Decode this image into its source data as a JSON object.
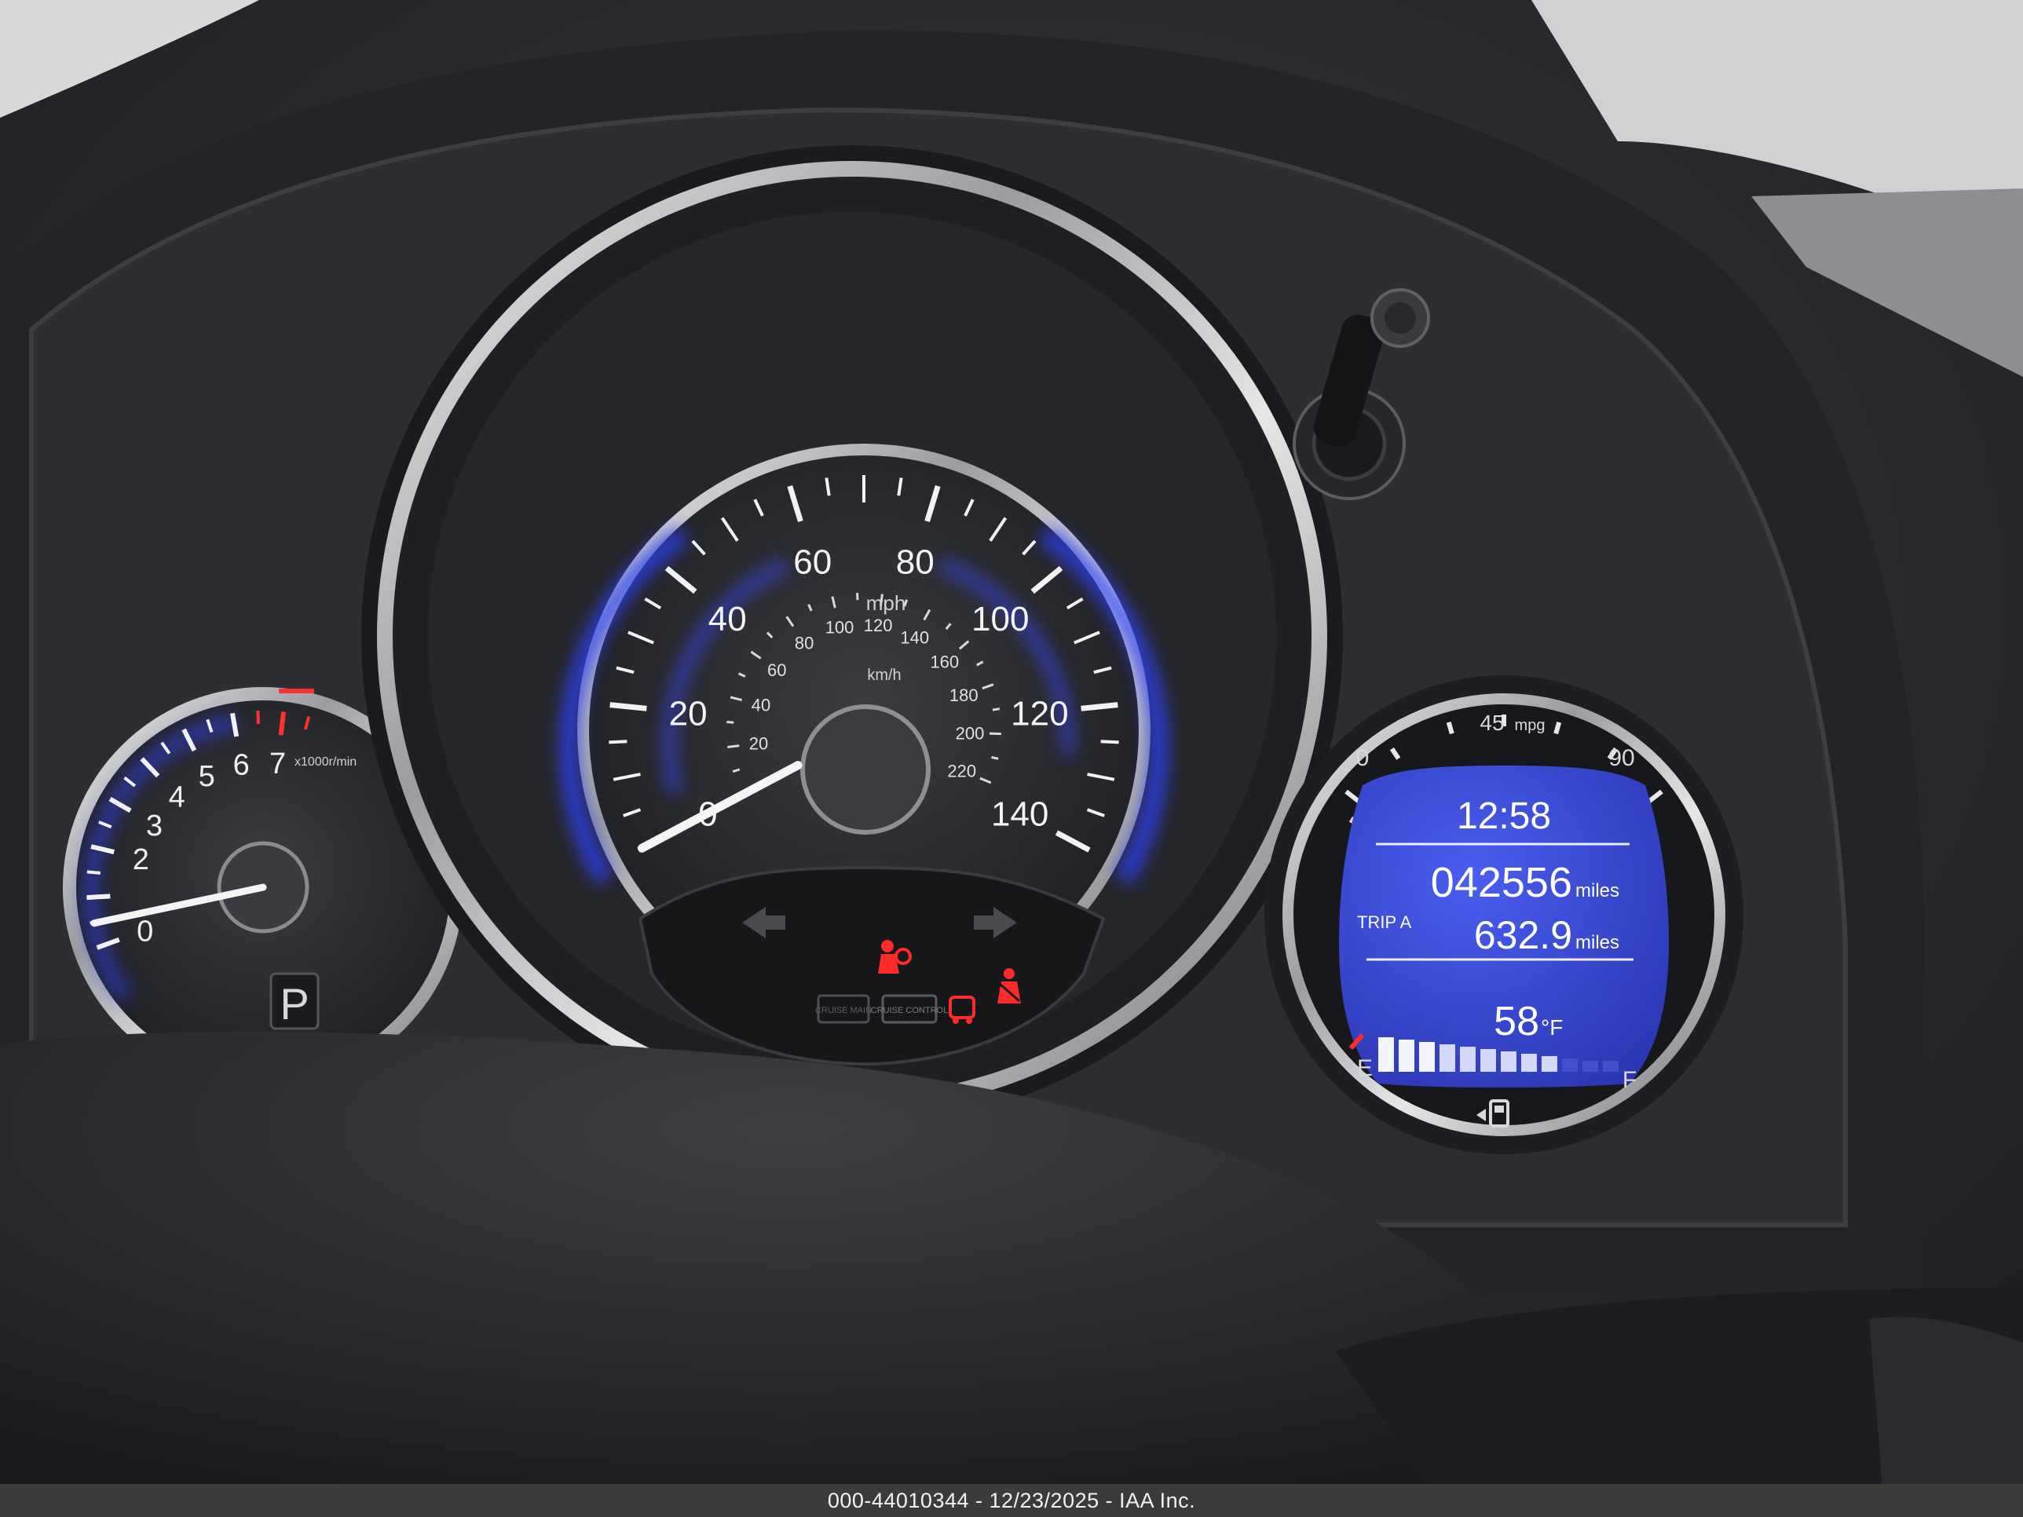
{
  "speedometer": {
    "mph_labels": [
      "0",
      "20",
      "40",
      "60",
      "80",
      "100",
      "120",
      "140"
    ],
    "unit_mph": "mph",
    "kmh_labels": [
      "20",
      "40",
      "60",
      "80",
      "100",
      "120",
      "140",
      "160",
      "180",
      "200",
      "220"
    ],
    "unit_kmh": "km/h",
    "speed_mph": 0
  },
  "tachometer": {
    "labels": [
      "0",
      "2",
      "3",
      "4",
      "5",
      "6",
      "7"
    ],
    "unit": "x1000r/min",
    "rpm_x1000": 0
  },
  "gear": {
    "position": "P"
  },
  "mpg_gauge": {
    "min_label": "0",
    "mid_label": "45",
    "mid_unit": "mpg",
    "max_label": "90"
  },
  "display": {
    "clock": "12:58",
    "odometer": "042556",
    "odometer_unit": "miles",
    "trip_label": "TRIP A",
    "trip_value": "632.9",
    "trip_unit": "miles",
    "temperature": "58",
    "temperature_unit": "°F"
  },
  "fuel_gauge": {
    "empty_label": "E",
    "full_label": "F",
    "level": 0.75
  },
  "indicators": {
    "cruise_main_text": "CRUISE MAIN",
    "cruise_control_text": "CRUISE CONTROL"
  },
  "caption": "000-44010344 - 12/23/2025 - IAA Inc.",
  "colors": {
    "display_blue": "#3a4cd6",
    "backlight_blue": "#2e3ff0",
    "warning_red": "#ff2a2a",
    "needle_white": "#f4f4f4"
  }
}
